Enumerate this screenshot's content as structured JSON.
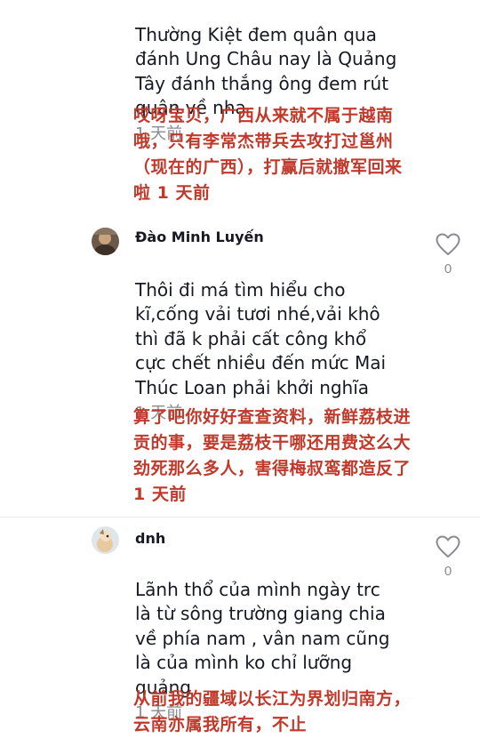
{
  "comments": [
    {
      "text": "Thường Kiệt đem quân qua\nđánh Ung Châu nay là Quảng\nTây đánh thắng ông đem rút\nquân về nha",
      "time": "1 天前",
      "translation": "哎呀宝贝，广西从来就不属于越南哦，只有李常杰带兵去攻打过邕州（现在的广西），打赢后就撤军回来啦",
      "translation_time": "1 天前"
    },
    {
      "username": "Đào Minh Luyến",
      "text": "Thôi đi má tìm hiểu cho\nkĩ,cống vải tươi nhé,vải khô\nthì đã k phải cất công khổ\ncực chết nhiều đến mức Mai\nThúc Loan phải khởi nghĩa",
      "time": "1 天前",
      "likes": "0",
      "translation": "算了吧你好好查查资料，新鲜荔枝进贡的事，要是荔枝干哪还用费这么大劲死那么多人，害得梅叔鸾都造反了",
      "translation_time": "1 天前"
    },
    {
      "username": "dnh",
      "text": "Lãnh thổ của mình ngày trc\nlà từ sông trường giang chia\nvề phía nam , vân nam cũng\nlà của mình ko chỉ lưỡng\nquảng",
      "time": "1 天前",
      "likes": "0",
      "translation": "从前我的疆域以长江为界划归南方，云南亦属我所有，不止"
    }
  ]
}
